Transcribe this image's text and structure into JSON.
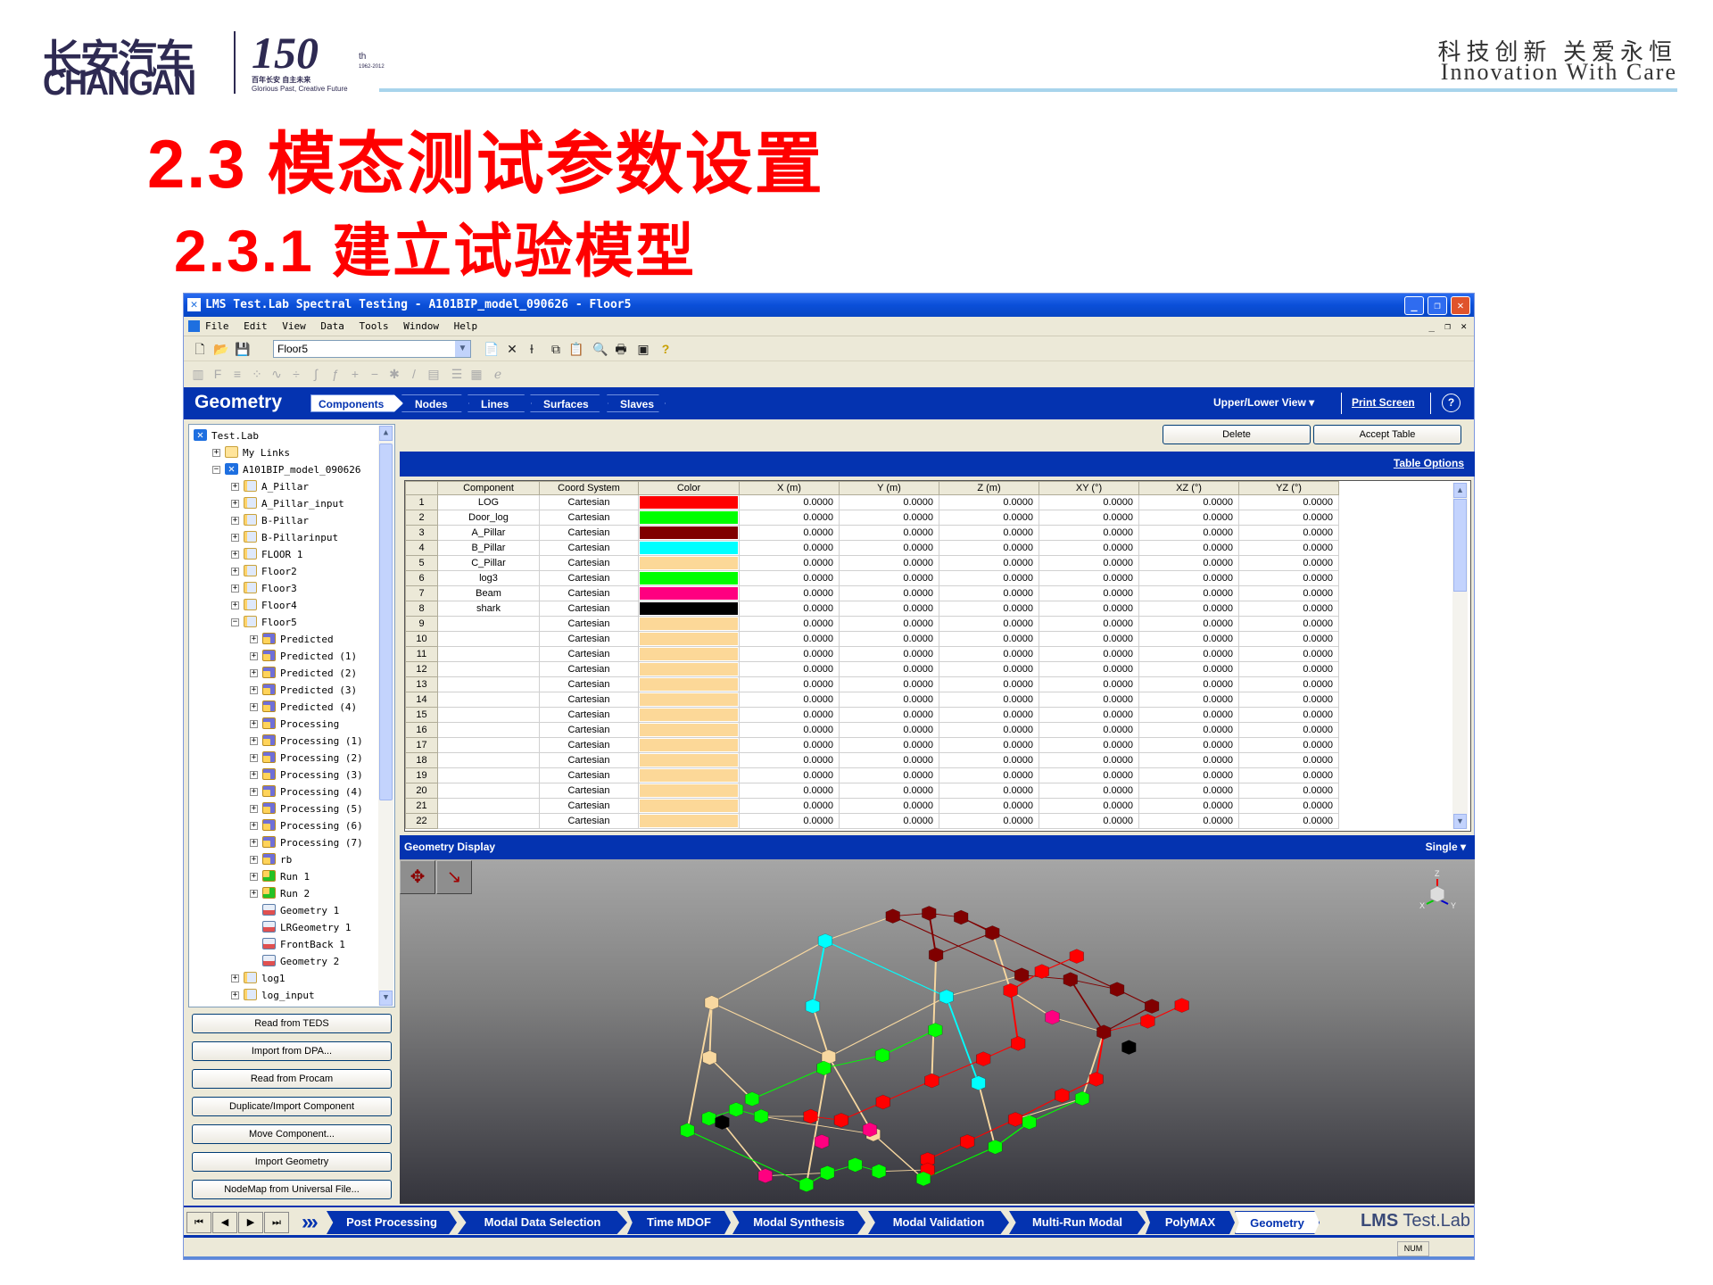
{
  "header": {
    "logo_cn": "长安汽车",
    "logo_en": "CHANGAN",
    "anniversary": "150",
    "anniversary_suffix": "th",
    "anniversary_years": "1962-2012",
    "tagline_cn": "百年长安  自主未来",
    "tagline_en": "Glorious Past, Creative Future",
    "slogan_cn": "科技创新 关爱永恒",
    "slogan_en": "Innovation With Care",
    "accent_line_color": "#a8d4ec"
  },
  "slide": {
    "title": "2.3 模态测试参数设置",
    "subtitle": "2.3.1 建立试验模型",
    "title_color": "#ff0000"
  },
  "app": {
    "window_title": "LMS Test.Lab Spectral Testing - A101BIP_model_090626 - Floor5",
    "menu": [
      "File",
      "Edit",
      "View",
      "Data",
      "Tools",
      "Window",
      "Help"
    ],
    "toolbar": {
      "project": "Floor5"
    },
    "geometry": {
      "title": "Geometry",
      "tabs": [
        "Components",
        "Nodes",
        "Lines",
        "Surfaces",
        "Slaves"
      ],
      "active_tab": "Components",
      "view_mode": "Upper/Lower View",
      "print_screen": "Print Screen",
      "help": "?"
    },
    "tree": [
      {
        "label": "Test.Lab",
        "level": 0,
        "exp": "",
        "icon": "lab"
      },
      {
        "label": "My Links",
        "level": 1,
        "exp": "+",
        "icon": "folder"
      },
      {
        "label": "A101BIP_model_090626",
        "level": 1,
        "exp": "-",
        "icon": "lab"
      },
      {
        "label": "A_Pillar",
        "level": 2,
        "exp": "+",
        "icon": "folder-blue"
      },
      {
        "label": "A_Pillar_input",
        "level": 2,
        "exp": "+",
        "icon": "folder-blue"
      },
      {
        "label": "B-Pillar",
        "level": 2,
        "exp": "+",
        "icon": "folder-blue"
      },
      {
        "label": "B-Pillarinput",
        "level": 2,
        "exp": "+",
        "icon": "folder-blue"
      },
      {
        "label": "FLOOR 1",
        "level": 2,
        "exp": "+",
        "icon": "folder-blue"
      },
      {
        "label": "Floor2",
        "level": 2,
        "exp": "+",
        "icon": "folder-blue"
      },
      {
        "label": "Floor3",
        "level": 2,
        "exp": "+",
        "icon": "folder-blue"
      },
      {
        "label": "Floor4",
        "level": 2,
        "exp": "+",
        "icon": "folder-blue"
      },
      {
        "label": "Floor5",
        "level": 2,
        "exp": "-",
        "icon": "folder-blue"
      },
      {
        "label": "Predicted",
        "level": 3,
        "exp": "+",
        "icon": "gear"
      },
      {
        "label": "Predicted (1)",
        "level": 3,
        "exp": "+",
        "icon": "gear"
      },
      {
        "label": "Predicted (2)",
        "level": 3,
        "exp": "+",
        "icon": "gear"
      },
      {
        "label": "Predicted (3)",
        "level": 3,
        "exp": "+",
        "icon": "gear"
      },
      {
        "label": "Predicted (4)",
        "level": 3,
        "exp": "+",
        "icon": "gear"
      },
      {
        "label": "Processing",
        "level": 3,
        "exp": "+",
        "icon": "gear"
      },
      {
        "label": "Processing (1)",
        "level": 3,
        "exp": "+",
        "icon": "gear"
      },
      {
        "label": "Processing (2)",
        "level": 3,
        "exp": "+",
        "icon": "gear"
      },
      {
        "label": "Processing (3)",
        "level": 3,
        "exp": "+",
        "icon": "gear"
      },
      {
        "label": "Processing (4)",
        "level": 3,
        "exp": "+",
        "icon": "gear"
      },
      {
        "label": "Processing (5)",
        "level": 3,
        "exp": "+",
        "icon": "gear"
      },
      {
        "label": "Processing (6)",
        "level": 3,
        "exp": "+",
        "icon": "gear"
      },
      {
        "label": "Processing (7)",
        "level": 3,
        "exp": "+",
        "icon": "gear"
      },
      {
        "label": "rb",
        "level": 3,
        "exp": "+",
        "icon": "gear"
      },
      {
        "label": "Run 1",
        "level": 3,
        "exp": "+",
        "icon": "run"
      },
      {
        "label": "Run 2",
        "level": 3,
        "exp": "+",
        "icon": "run"
      },
      {
        "label": "Geometry 1",
        "level": 3,
        "exp": "",
        "icon": "geo"
      },
      {
        "label": "LRGeometry 1",
        "level": 3,
        "exp": "",
        "icon": "geo"
      },
      {
        "label": "FrontBack 1",
        "level": 3,
        "exp": "",
        "icon": "geo"
      },
      {
        "label": "Geometry 2",
        "level": 3,
        "exp": "",
        "icon": "geo"
      },
      {
        "label": "log1",
        "level": 2,
        "exp": "+",
        "icon": "folder-blue"
      },
      {
        "label": "log_input",
        "level": 2,
        "exp": "+",
        "icon": "folder-blue"
      }
    ],
    "side_buttons": [
      "Read from TEDS",
      "Import from DPA...",
      "Read from Procam",
      "Duplicate/Import Component",
      "Move Component...",
      "Import Geometry",
      "NodeMap from Universal File..."
    ],
    "actions": {
      "delete": "Delete",
      "accept": "Accept Table",
      "table_options": "Table Options"
    },
    "table": {
      "columns": [
        "",
        "Component",
        "Coord System",
        "Color",
        "X (m)",
        "Y (m)",
        "Z (m)",
        "XY (°)",
        "XZ (°)",
        "YZ (°)"
      ],
      "rows": [
        [
          "1",
          "LOG",
          "Cartesian",
          "#ff0000",
          "0.0000",
          "0.0000",
          "0.0000",
          "0.0000",
          "0.0000",
          "0.0000"
        ],
        [
          "2",
          "Door_log",
          "Cartesian",
          "#00ff00",
          "0.0000",
          "0.0000",
          "0.0000",
          "0.0000",
          "0.0000",
          "0.0000"
        ],
        [
          "3",
          "A_Pillar",
          "Cartesian",
          "#800000",
          "0.0000",
          "0.0000",
          "0.0000",
          "0.0000",
          "0.0000",
          "0.0000"
        ],
        [
          "4",
          "B_Pillar",
          "Cartesian",
          "#00ffff",
          "0.0000",
          "0.0000",
          "0.0000",
          "0.0000",
          "0.0000",
          "0.0000"
        ],
        [
          "5",
          "C_Pillar",
          "Cartesian",
          "#fcd898",
          "0.0000",
          "0.0000",
          "0.0000",
          "0.0000",
          "0.0000",
          "0.0000"
        ],
        [
          "6",
          "log3",
          "Cartesian",
          "#00ff00",
          "0.0000",
          "0.0000",
          "0.0000",
          "0.0000",
          "0.0000",
          "0.0000"
        ],
        [
          "7",
          "Beam",
          "Cartesian",
          "#ff0080",
          "0.0000",
          "0.0000",
          "0.0000",
          "0.0000",
          "0.0000",
          "0.0000"
        ],
        [
          "8",
          "shark",
          "Cartesian",
          "#000000",
          "0.0000",
          "0.0000",
          "0.0000",
          "0.0000",
          "0.0000",
          "0.0000"
        ],
        [
          "9",
          "",
          "Cartesian",
          "#fcd898",
          "0.0000",
          "0.0000",
          "0.0000",
          "0.0000",
          "0.0000",
          "0.0000"
        ],
        [
          "10",
          "",
          "Cartesian",
          "#fcd898",
          "0.0000",
          "0.0000",
          "0.0000",
          "0.0000",
          "0.0000",
          "0.0000"
        ],
        [
          "11",
          "",
          "Cartesian",
          "#fcd898",
          "0.0000",
          "0.0000",
          "0.0000",
          "0.0000",
          "0.0000",
          "0.0000"
        ],
        [
          "12",
          "",
          "Cartesian",
          "#fcd898",
          "0.0000",
          "0.0000",
          "0.0000",
          "0.0000",
          "0.0000",
          "0.0000"
        ],
        [
          "13",
          "",
          "Cartesian",
          "#fcd898",
          "0.0000",
          "0.0000",
          "0.0000",
          "0.0000",
          "0.0000",
          "0.0000"
        ],
        [
          "14",
          "",
          "Cartesian",
          "#fcd898",
          "0.0000",
          "0.0000",
          "0.0000",
          "0.0000",
          "0.0000",
          "0.0000"
        ],
        [
          "15",
          "",
          "Cartesian",
          "#fcd898",
          "0.0000",
          "0.0000",
          "0.0000",
          "0.0000",
          "0.0000",
          "0.0000"
        ],
        [
          "16",
          "",
          "Cartesian",
          "#fcd898",
          "0.0000",
          "0.0000",
          "0.0000",
          "0.0000",
          "0.0000",
          "0.0000"
        ],
        [
          "17",
          "",
          "Cartesian",
          "#fcd898",
          "0.0000",
          "0.0000",
          "0.0000",
          "0.0000",
          "0.0000",
          "0.0000"
        ],
        [
          "18",
          "",
          "Cartesian",
          "#fcd898",
          "0.0000",
          "0.0000",
          "0.0000",
          "0.0000",
          "0.0000",
          "0.0000"
        ],
        [
          "19",
          "",
          "Cartesian",
          "#fcd898",
          "0.0000",
          "0.0000",
          "0.0000",
          "0.0000",
          "0.0000",
          "0.0000"
        ],
        [
          "20",
          "",
          "Cartesian",
          "#fcd898",
          "0.0000",
          "0.0000",
          "0.0000",
          "0.0000",
          "0.0000",
          "0.0000"
        ],
        [
          "21",
          "",
          "Cartesian",
          "#fcd898",
          "0.0000",
          "0.0000",
          "0.0000",
          "0.0000",
          "0.0000",
          "0.0000"
        ],
        [
          "22",
          "",
          "Cartesian",
          "#fcd898",
          "0.0000",
          "0.0000",
          "0.0000",
          "0.0000",
          "0.0000",
          "0.0000"
        ]
      ]
    },
    "display": {
      "title": "Geometry Display",
      "mode": "Single",
      "axes": [
        "Z",
        "X",
        "Y"
      ]
    },
    "workflow": {
      "tabs": [
        "Post Processing",
        "Modal Data Selection",
        "Time MDOF",
        "Modal Synthesis",
        "Modal Validation",
        "Multi-Run Modal",
        "PolyMAX",
        "Geometry"
      ],
      "active": "Geometry",
      "brand_bold": "LMS",
      "brand_rest": " Test.Lab"
    },
    "status": {
      "num": "NUM"
    },
    "colors": {
      "brand_blue": "#0433b0",
      "titlebar": "#0a4fd8"
    }
  }
}
